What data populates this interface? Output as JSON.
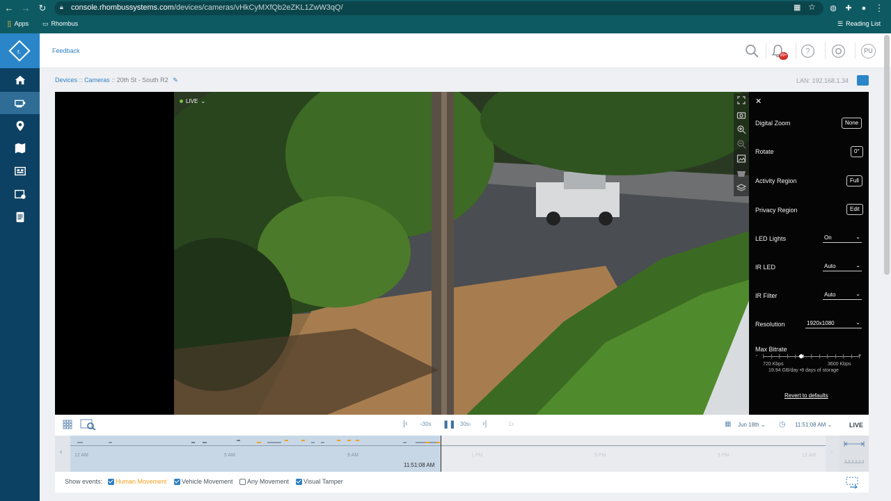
{
  "browser": {
    "url_host": "console.rhombussystems.com",
    "url_path": "/devices/cameras/vHkCyMXfQb2eZKL1ZwW3qQ/",
    "bookmarks": {
      "apps": "Apps",
      "folder": "Rhombus",
      "reading_list": "Reading List"
    }
  },
  "topbar": {
    "feedback": "Feedback",
    "notification_count": "99+",
    "avatar_initials": "PU"
  },
  "breadcrumb": {
    "devices": "Devices",
    "cameras": "Cameras",
    "camera": "20th St - South R2",
    "separator": "::"
  },
  "lan": "LAN: 192.168.1.34",
  "player": {
    "live_label": "LIVE"
  },
  "settings": {
    "digital_zoom": {
      "label": "Digital Zoom",
      "value": "None"
    },
    "rotate": {
      "label": "Rotate",
      "value": "0°"
    },
    "activity_region": {
      "label": "Activity Region",
      "value": "Full"
    },
    "privacy_region": {
      "label": "Privacy Region",
      "value": "Edit"
    },
    "led_lights": {
      "label": "LED Lights",
      "value": "On"
    },
    "ir_led": {
      "label": "IR LED",
      "value": "Auto"
    },
    "ir_filter": {
      "label": "IR Filter",
      "value": "Auto"
    },
    "resolution": {
      "label": "Resolution",
      "value": "1920x1080"
    },
    "max_bitrate": {
      "label": "Max Bitrate",
      "min": "720 Kbps",
      "max": "3600 Kbps",
      "minus": "-",
      "plus": "+",
      "storage": "19.94 GB/day •8 days of storage",
      "level": 0.4
    },
    "revert": "Revert to defaults"
  },
  "controls": {
    "back": "30s",
    "forward": "30s",
    "speed": "1x",
    "date": "Jun 18th",
    "time": "11:51:08 AM",
    "live": "LIVE"
  },
  "timeline": {
    "labels": [
      "12 AM",
      "5 AM",
      "9 AM",
      "1 PM",
      "5 PM",
      "9 PM",
      "12 AM"
    ],
    "now": "11:51:08 AM"
  },
  "events": {
    "title": "Show events:",
    "human": "Human Movement",
    "vehicle": "Vehicle Movement",
    "any": "Any Movement",
    "tamper": "Visual Tamper"
  },
  "colors": {
    "accent": "#2a86c9",
    "sidebar": "#0d4163",
    "human_movement": "#f0a020"
  }
}
